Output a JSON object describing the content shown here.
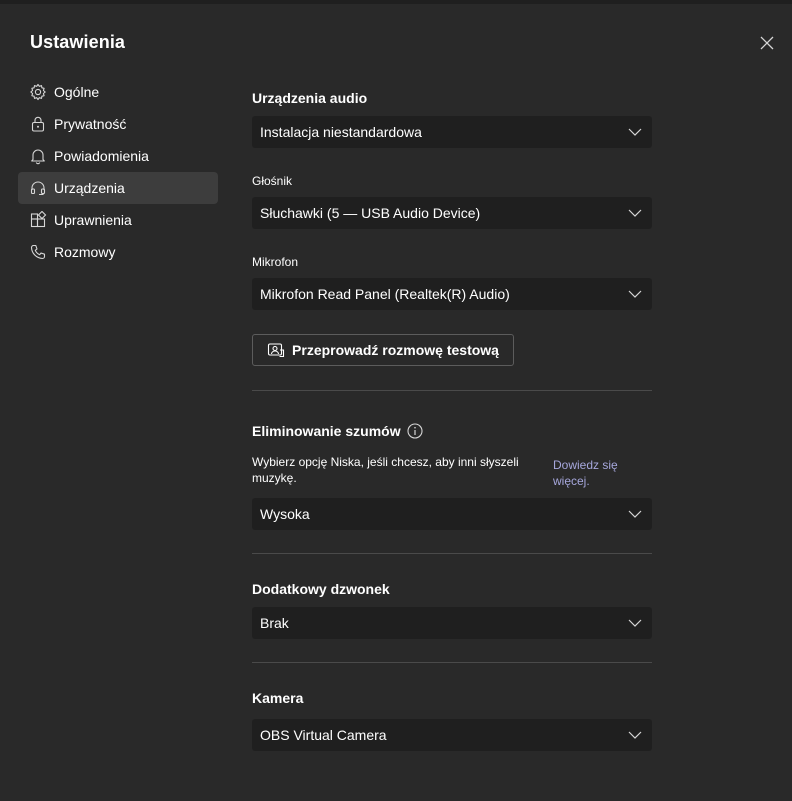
{
  "dialog": {
    "title": "Ustawienia",
    "close_icon": "close-icon"
  },
  "sidebar": {
    "items": [
      {
        "label": "Ogólne",
        "icon": "gear-icon",
        "active": false
      },
      {
        "label": "Prywatność",
        "icon": "lock-icon",
        "active": false
      },
      {
        "label": "Powiadomienia",
        "icon": "bell-icon",
        "active": false
      },
      {
        "label": "Urządzenia",
        "icon": "headset-icon",
        "active": true
      },
      {
        "label": "Uprawnienia",
        "icon": "apps-icon",
        "active": false
      },
      {
        "label": "Rozmowy",
        "icon": "phone-icon",
        "active": false
      }
    ]
  },
  "audio": {
    "title": "Urządzenia audio",
    "device_value": "Instalacja niestandardowa",
    "speaker_label": "Głośnik",
    "speaker_value": "Słuchawki (5 — USB Audio Device)",
    "mic_label": "Mikrofon",
    "mic_value": "Mikrofon Read Panel (Realtek(R) Audio)",
    "test_call_label": "Przeprowadź rozmowę testową"
  },
  "noise": {
    "title": "Eliminowanie szumów",
    "description": "Wybierz opcję Niska, jeśli chcesz, aby inni słyszeli muzykę.",
    "learn_more": "Dowiedz się więcej.",
    "value": "Wysoka"
  },
  "ringer": {
    "title": "Dodatkowy dzwonek",
    "value": "Brak"
  },
  "camera": {
    "title": "Kamera",
    "value": "OBS Virtual Camera"
  },
  "colors": {
    "background": "#292929",
    "select_background": "#1f1f1f",
    "active_nav": "#3d3d3d",
    "link": "#a6a7dc"
  }
}
